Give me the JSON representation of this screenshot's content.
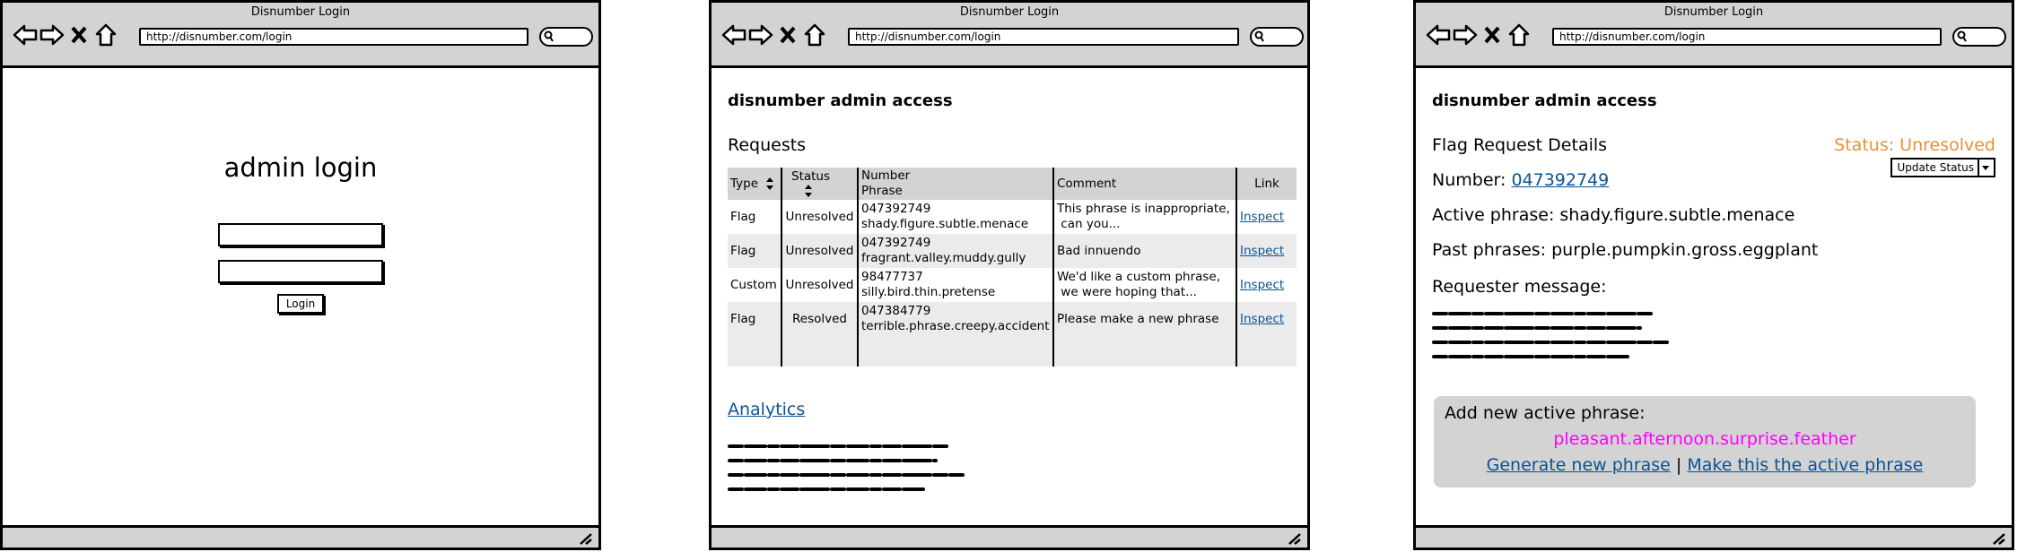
{
  "browser": {
    "title": "Disnumber Login",
    "url": "http://disnumber.com/login"
  },
  "login_window": {
    "heading": "admin login",
    "button_label": "Login"
  },
  "requests_window": {
    "page_title": "disnumber admin access",
    "section_title": "Requests",
    "columns": [
      "Type",
      "Status",
      "Number",
      "Phrase",
      "Comment",
      "Link"
    ],
    "rows": [
      {
        "type": "Flag",
        "status": "Unresolved",
        "number": "047392749",
        "phrase": "shady.figure.subtle.menace",
        "comment1": "This phrase is inappropriate,",
        "comment2": " can you...",
        "link": "Inspect"
      },
      {
        "type": "Flag",
        "status": "Unresolved",
        "number": "047392749",
        "phrase": "fragrant.valley.muddy.gully",
        "comment1": "Bad innuendo",
        "comment2": "",
        "link": "Inspect"
      },
      {
        "type": "Custom",
        "status": "Unresolved",
        "number": "98477737",
        "phrase": "silly.bird.thin.pretense",
        "comment1": "We'd like a custom phrase,",
        "comment2": " we were hoping that...",
        "link": "Inspect"
      },
      {
        "type": "Flag",
        "status": "Resolved",
        "number": "047384779",
        "phrase": "terrible.phrase.creepy.accident",
        "comment1": "Please make a new phrase",
        "comment2": "",
        "link": "Inspect"
      }
    ],
    "analytics_link": "Analytics"
  },
  "detail_window": {
    "page_title": "disnumber admin access",
    "section_title": "Flag Request Details",
    "status_text": "Status: Unresolved",
    "update_button": "Update Status",
    "number_label": "Number:",
    "number_value": "047392749",
    "active_phrase": "Active phrase: shady.figure.subtle.menace",
    "past_phrases": "Past phrases: purple.pumpkin.gross.eggplant",
    "message_label": "Requester message:",
    "add_label": "Add new active phrase:",
    "new_phrase": "pleasant.afternoon.surprise.feather",
    "generate_link": "Generate new phrase",
    "separator": "|",
    "make_active_link": "Make this the active phrase"
  },
  "colors": {
    "chrome": "#d3d3d3",
    "link": "#0b5394",
    "status_unresolved": "#e69138",
    "new_phrase": "#ff00ff"
  },
  "icons": [
    "back-arrow-icon",
    "forward-arrow-icon",
    "close-x-icon",
    "home-icon",
    "search-icon",
    "resize-grip-icon",
    "sort-icon",
    "dropdown-arrow-icon"
  ]
}
